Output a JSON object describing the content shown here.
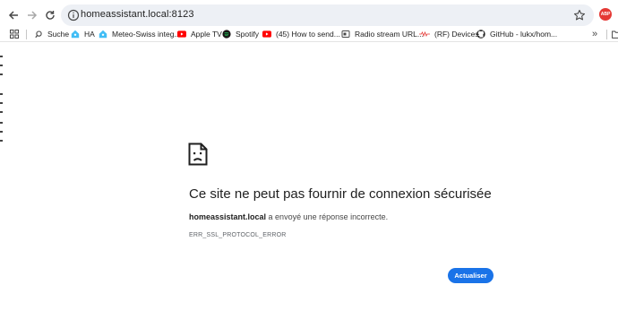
{
  "toolbar": {
    "url": "homeassistant.local:8123",
    "extension_badge": "ABP"
  },
  "bookmarks": [
    {
      "label": "Suche",
      "icon": "search-icon"
    },
    {
      "label": "HA",
      "icon": "home-assistant-icon"
    },
    {
      "label": "Meteo-Swiss integ...",
      "icon": "home-assistant-icon"
    },
    {
      "label": "Apple TV",
      "icon": "youtube-icon"
    },
    {
      "label": "Spotify",
      "icon": "spotify-icon"
    },
    {
      "label": "(45) How to send...",
      "icon": "youtube-icon"
    },
    {
      "label": "Radio stream URL...",
      "icon": "page-icon"
    },
    {
      "label": "(RF) Devices",
      "icon": "rf-icon"
    },
    {
      "label": "GitHub - lukx/hom...",
      "icon": "github-icon"
    }
  ],
  "error": {
    "title": "Ce site ne peut pas fournir de connexion sécurisée",
    "host": "homeassistant.local",
    "message": " a envoyé une réponse incorrecte.",
    "code": "ERR_SSL_PROTOCOL_ERROR",
    "reload_label": "Actualiser"
  },
  "colors": {
    "accent": "#1a73e8",
    "omnibox_bg": "#edf0f5",
    "youtube": "#ff0000",
    "home_assistant": "#41bdf5",
    "badge": "#e53935"
  }
}
